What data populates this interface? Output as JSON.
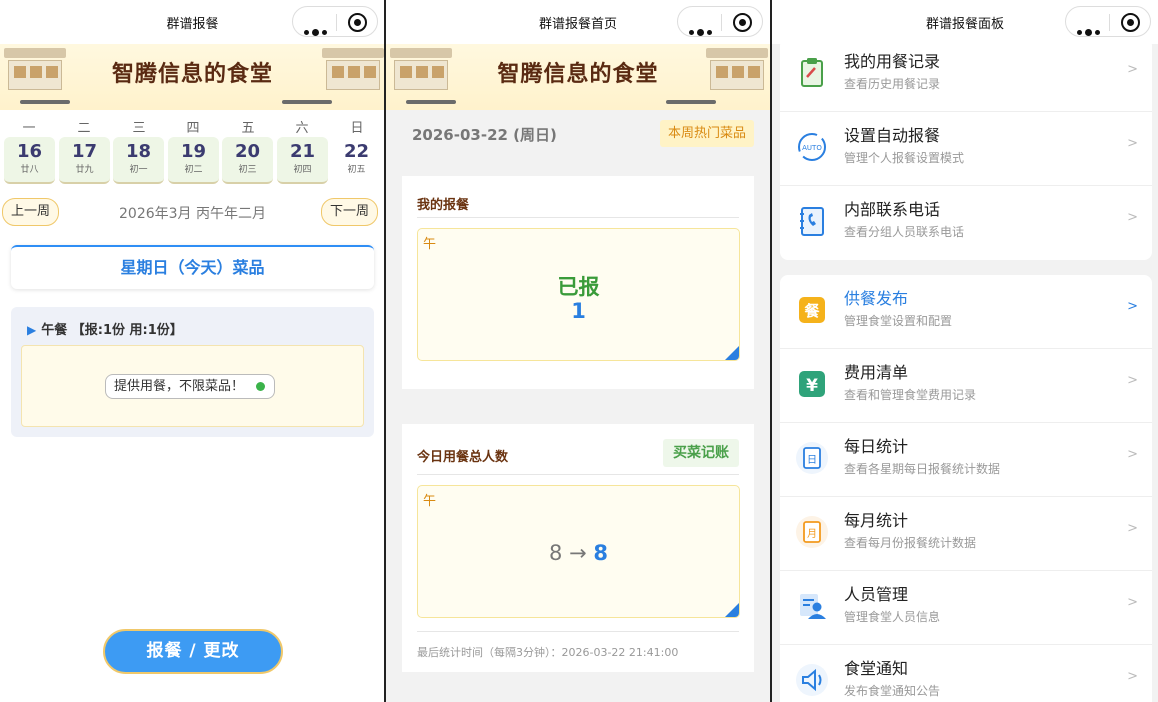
{
  "panel1": {
    "topbar_title": "群谱报餐",
    "banner_title": "智腾信息的食堂",
    "weekdays": [
      "一",
      "二",
      "三",
      "四",
      "五",
      "六",
      "日"
    ],
    "days": [
      {
        "num": "16",
        "lunar": "廿八"
      },
      {
        "num": "17",
        "lunar": "廿九"
      },
      {
        "num": "18",
        "lunar": "初一"
      },
      {
        "num": "19",
        "lunar": "初二"
      },
      {
        "num": "20",
        "lunar": "初三"
      },
      {
        "num": "21",
        "lunar": "初四"
      },
      {
        "num": "22",
        "lunar": "初五"
      }
    ],
    "prev_week": "上一周",
    "next_week": "下一周",
    "month_label": "2026年3月 丙午年二月",
    "today_title": "星期日（今天）菜品",
    "meal_marker": "▶",
    "meal_header": "午餐 【报:1份 用:1份】",
    "meal_chip": "提供用餐，不限菜品！",
    "chip_dot_color": "#3bb34a",
    "main_button": "报餐 / 更改"
  },
  "panel2": {
    "topbar_title": "群谱报餐首页",
    "banner_title": "智腾信息的食堂",
    "date": "2026-03-22 (周日)",
    "hot_button": "本周热门菜品",
    "my_meal_title": "我的报餐",
    "my_meal_tag": "午",
    "my_meal_status": "已报",
    "my_meal_count": "1",
    "total_title": "今日用餐总人数",
    "buy_button": "买菜记账",
    "total_tag": "午",
    "total_from": "8",
    "total_arrow": "→",
    "total_to": "8",
    "footnote": "最后统计时间（每隔3分钟）：2026-03-22 21:41:00"
  },
  "panel3": {
    "topbar_title": "群谱报餐面板",
    "group1": [
      {
        "title": "我的用餐记录",
        "sub": "查看历史用餐记录",
        "icon": "clipboard-icon",
        "color": "#4aa04a"
      },
      {
        "title": "设置自动报餐",
        "sub": "管理个人报餐设置模式",
        "icon": "auto-cycle-icon",
        "color": "#2a7fe0"
      },
      {
        "title": "内部联系电话",
        "sub": "查看分组人员联系电话",
        "icon": "phone-book-icon",
        "color": "#2a7fe0"
      }
    ],
    "group2": [
      {
        "title": "供餐发布",
        "sub": "管理食堂设置和配置",
        "icon": "meal-publish-icon",
        "color": "#f5b21b",
        "glyph": "餐"
      },
      {
        "title": "费用清单",
        "sub": "查看和管理食堂费用记录",
        "icon": "yuan-icon",
        "color": "#2fa37a",
        "glyph": "¥"
      },
      {
        "title": "每日统计",
        "sub": "查看各星期每日报餐统计数据",
        "icon": "daily-stats-icon",
        "color": "#2a7fe0",
        "glyph": "日"
      },
      {
        "title": "每月统计",
        "sub": "查看每月份报餐统计数据",
        "icon": "monthly-stats-icon",
        "color": "#f39a1e",
        "glyph": "月"
      },
      {
        "title": "人员管理",
        "sub": "管理食堂人员信息",
        "icon": "staff-icon",
        "color": "#2a7fe0"
      },
      {
        "title": "食堂通知",
        "sub": "发布食堂通知公告",
        "icon": "speaker-icon",
        "color": "#2a7fe0"
      }
    ],
    "arrow": ">"
  }
}
